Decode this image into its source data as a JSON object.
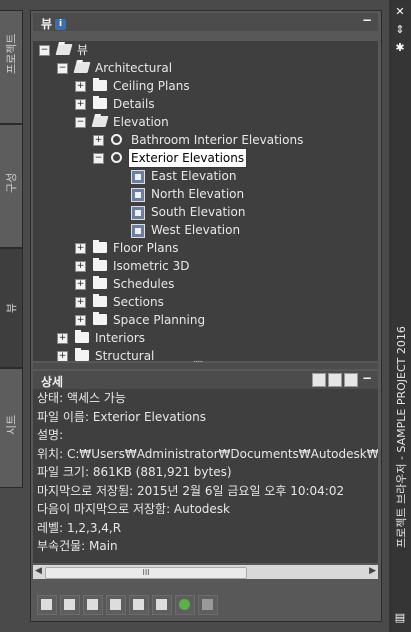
{
  "window": {
    "title": "프로젝트 브라우저 - SAMPLE PROJECT 2016"
  },
  "left_tabs": [
    "프로젝트",
    "구성",
    "뷰",
    "시트"
  ],
  "view_panel": {
    "label": "뷰",
    "minimize": "−"
  },
  "tree": {
    "root": "뷰",
    "architectural": "Architectural",
    "ceiling_plans": "Ceiling Plans",
    "details": "Details",
    "elevation": "Elevation",
    "bathroom": "Bathroom Interior Elevations",
    "exterior": "Exterior Elevations",
    "east": "East Elevation",
    "north": "North Elevation",
    "south": "South Elevation",
    "west": "West Elevation",
    "floor_plans": "Floor Plans",
    "isometric": "Isometric 3D",
    "schedules": "Schedules",
    "sections": "Sections",
    "space_planning": "Space Planning",
    "interiors": "Interiors",
    "structural": "Structural"
  },
  "details_panel": {
    "label": "상세",
    "rows": [
      "상태: 액세스 가능",
      "파일 이름: Exterior Elevations",
      "설명:",
      "위치: C:₩Users₩Administrator₩Documents₩Autodesk₩내 프로",
      "파일 크기: 861KB (881,921 bytes)",
      "마지막으로 저장됨: 2015년 2월 6일 금요일  오후 10:04:02",
      "다음이 마지막으로 저장함: Autodesk",
      "레벨: 1,2,3,4,R",
      "부속건물: Main"
    ]
  },
  "scrollbar": {
    "thumb_label": "III"
  }
}
